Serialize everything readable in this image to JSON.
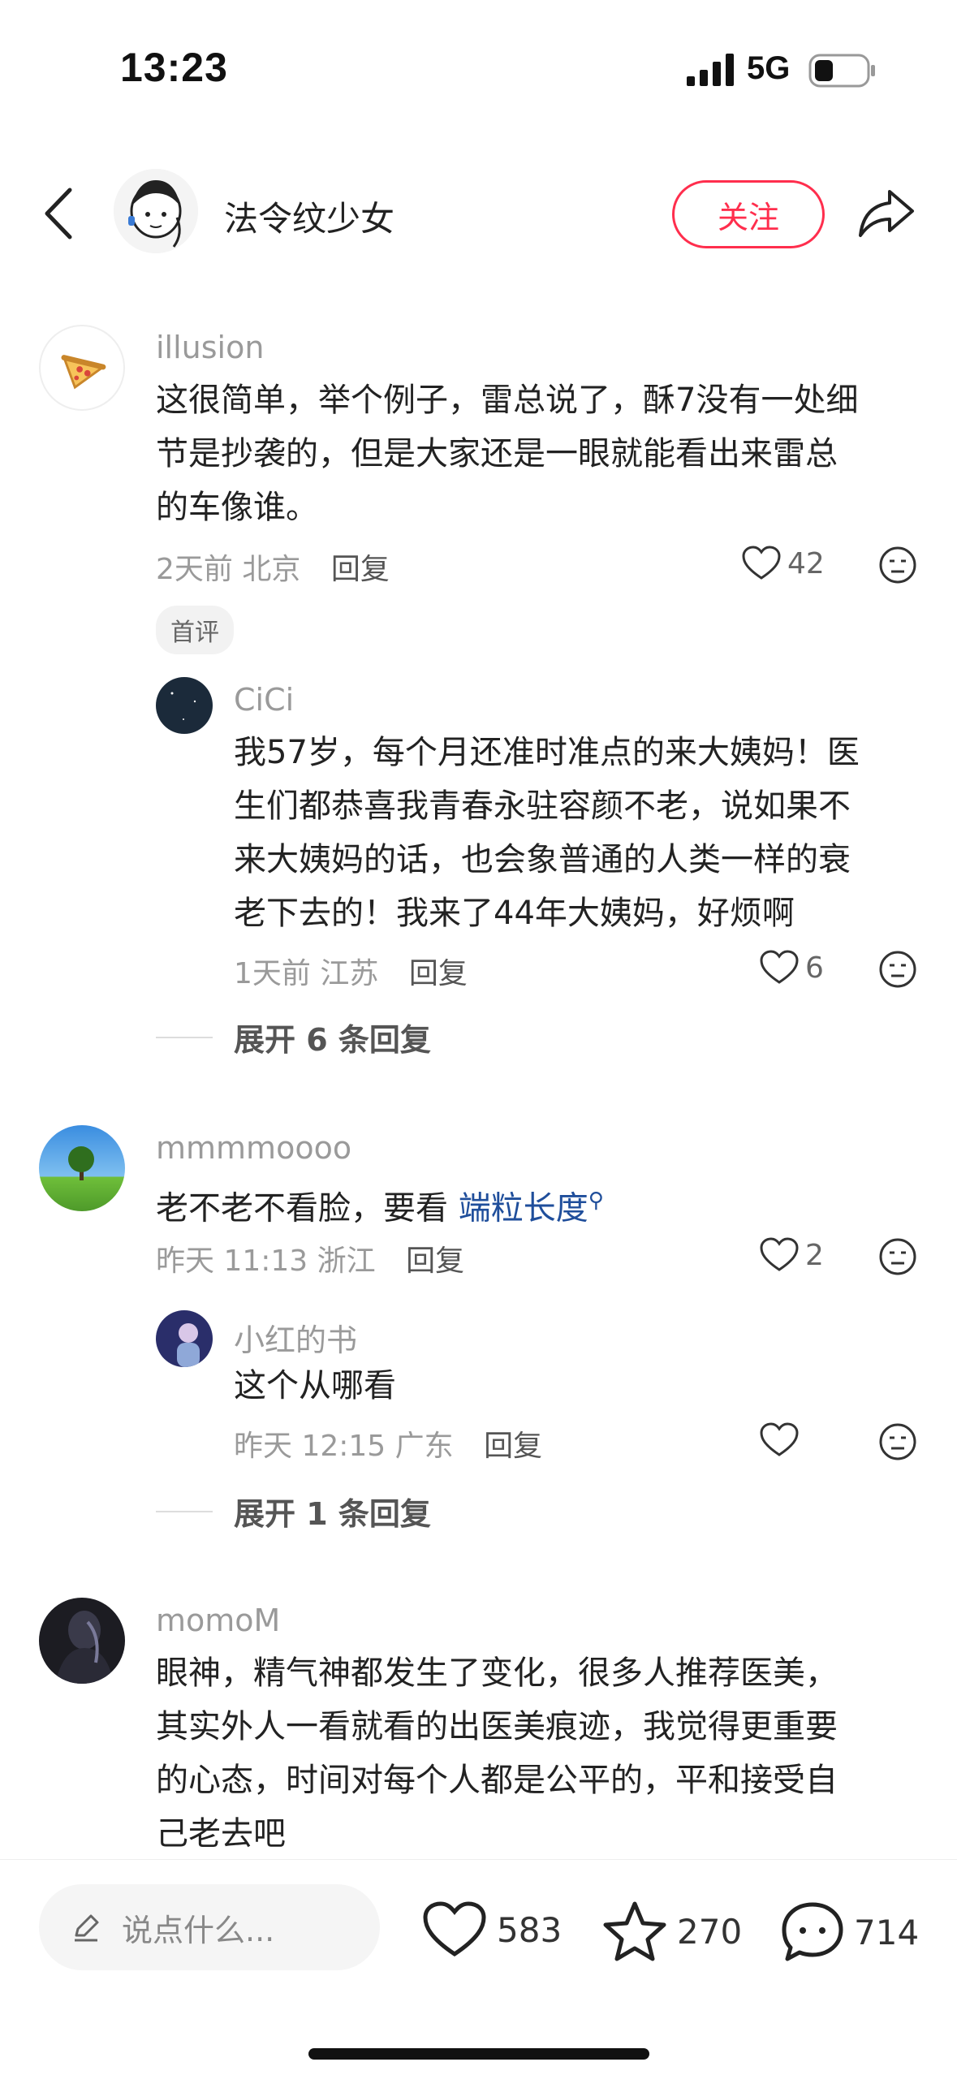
{
  "status_bar": {
    "time": "13:23",
    "network": "5G"
  },
  "header": {
    "author_name": "法令纹少女",
    "follow_label": "关注"
  },
  "comments": [
    {
      "name": "illusion",
      "text": [
        "这很简单，举个例子，雷总说了，酥7没有一处细",
        "节是抄袭的，但是大家还是一眼就能看出来雷总",
        "的车像谁。"
      ],
      "time": "2天前",
      "location": "北京",
      "reply_label": "回复",
      "likes": "42",
      "tag": "首评",
      "replies": [
        {
          "name": "CiCi",
          "text": [
            "我57岁，每个月还准时准点的来大姨妈！医",
            "生们都恭喜我青春永驻容颜不老，说如果不",
            "来大姨妈的话，也会象普通的人类一样的衰",
            "老下去的！我来了44年大姨妈，好烦啊"
          ],
          "time": "1天前",
          "location": "江苏",
          "reply_label": "回复",
          "likes": "6"
        }
      ],
      "expand_label": "展开 6 条回复"
    },
    {
      "name": "mmmmoooo",
      "text_prefix": "老不老不看脸，要看 ",
      "text_link": "端粒长度",
      "time": "昨天 11:13",
      "location": "浙江",
      "reply_label": "回复",
      "likes": "2",
      "replies": [
        {
          "name": "小红的书",
          "text": [
            "这个从哪看"
          ],
          "time": "昨天 12:15",
          "location": "广东",
          "reply_label": "回复",
          "likes": ""
        }
      ],
      "expand_label": "展开 1 条回复"
    },
    {
      "name": "momoM",
      "text": [
        "眼神，精气神都发生了变化，很多人推荐医美，",
        "其实外人一看就看的出医美痕迹，我觉得更重要",
        "的心态，时间对每个人都是公平的，平和接受自",
        "己老去吧"
      ]
    }
  ],
  "bottom_bar": {
    "input_placeholder": "说点什么...",
    "likes": "583",
    "favorites": "270",
    "comments": "714"
  },
  "colors": {
    "accent": "#ff2e4d",
    "link": "#1f4e9b",
    "meta": "#9a9a9a"
  }
}
